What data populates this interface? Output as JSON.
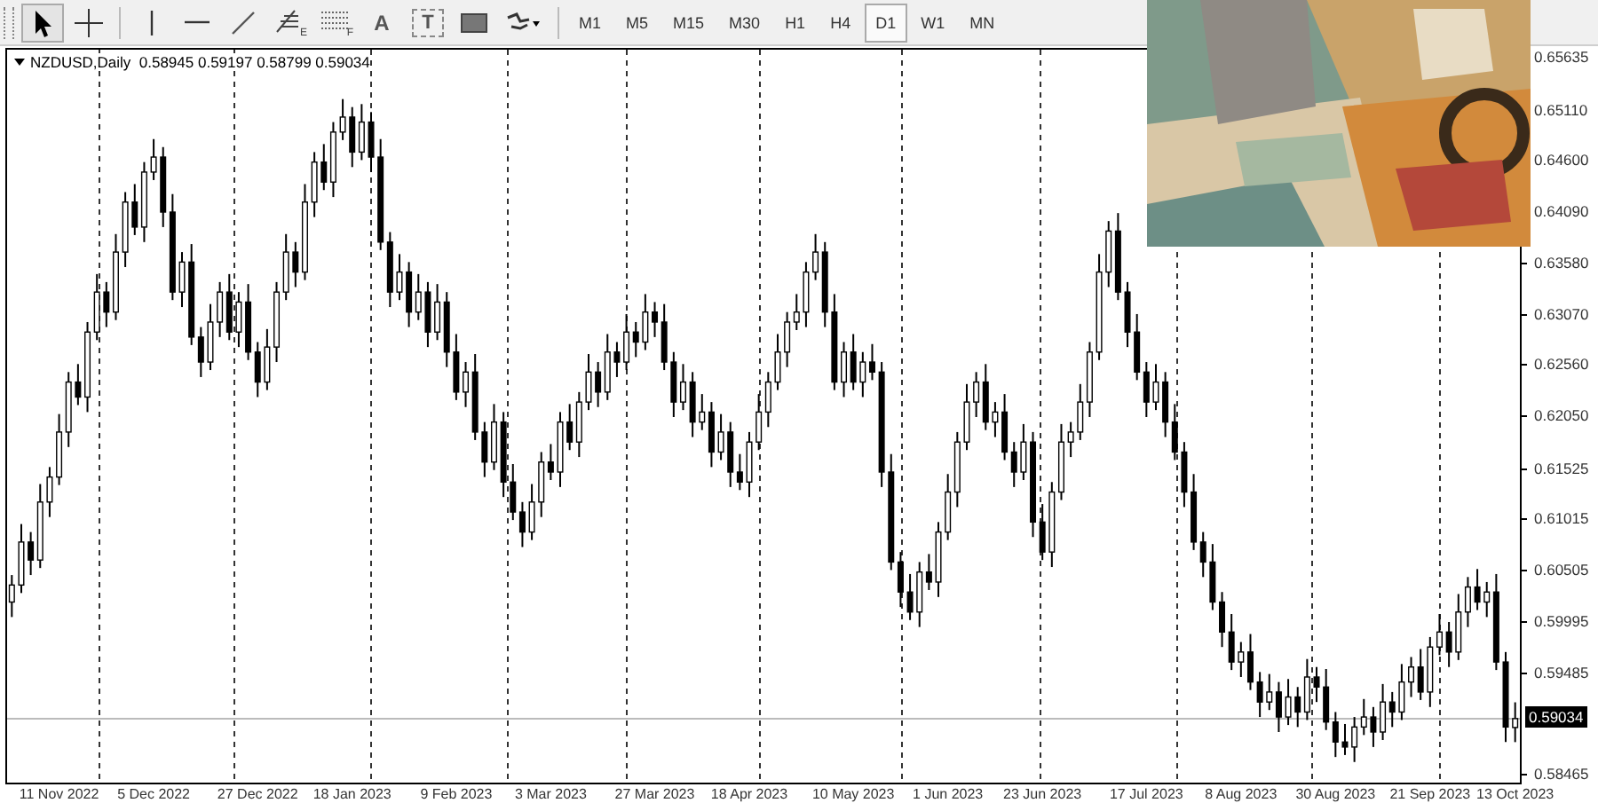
{
  "toolbar": {
    "tools": [
      {
        "kind": "cursor",
        "selected": true
      },
      {
        "kind": "crosshair",
        "selected": false
      },
      {
        "kind": "vline",
        "selected": false
      },
      {
        "kind": "hline",
        "selected": false
      },
      {
        "kind": "trend",
        "selected": false
      },
      {
        "kind": "fibo",
        "label": "E",
        "selected": false
      },
      {
        "kind": "grid",
        "label": "F",
        "selected": false
      },
      {
        "kind": "text",
        "label": "A",
        "selected": false
      },
      {
        "kind": "textlabel",
        "label": "T",
        "selected": false
      },
      {
        "kind": "rect",
        "selected": false
      },
      {
        "kind": "shapes",
        "selected": false
      }
    ],
    "timeframes": [
      {
        "label": "M1",
        "selected": false
      },
      {
        "label": "M5",
        "selected": false
      },
      {
        "label": "M15",
        "selected": false
      },
      {
        "label": "M30",
        "selected": false
      },
      {
        "label": "H1",
        "selected": false
      },
      {
        "label": "H4",
        "selected": false
      },
      {
        "label": "D1",
        "selected": true
      },
      {
        "label": "W1",
        "selected": false
      },
      {
        "label": "MN",
        "selected": false
      }
    ]
  },
  "chart": {
    "header": "NZDUSD,Daily  0.58945 0.59197 0.58799 0.59034",
    "last_price": "0.59034",
    "chart_data": {
      "type": "candlestick",
      "categories": [
        null,
        null,
        null,
        null,
        null,
        "11 Nov 2022",
        null,
        null,
        null,
        null,
        null,
        null,
        null,
        null,
        null,
        "5 Dec 2022",
        null,
        null,
        null,
        null,
        null,
        null,
        null,
        null,
        null,
        null,
        "27 Dec 2022",
        null,
        null,
        null,
        null,
        null,
        null,
        null,
        null,
        null,
        "18 Jan 2023",
        null,
        null,
        null,
        null,
        null,
        null,
        null,
        null,
        null,
        null,
        "9 Feb 2023",
        null,
        null,
        null,
        null,
        null,
        null,
        null,
        null,
        null,
        "3 Mar 2023",
        null,
        null,
        null,
        null,
        null,
        null,
        null,
        null,
        null,
        null,
        "27 Mar 2023",
        null,
        null,
        null,
        null,
        null,
        null,
        null,
        null,
        null,
        "18 Apr 2023",
        null,
        null,
        null,
        null,
        null,
        null,
        null,
        null,
        null,
        null,
        "10 May 2023",
        null,
        null,
        null,
        null,
        null,
        null,
        null,
        null,
        null,
        "1 Jun 2023",
        null,
        null,
        null,
        null,
        null,
        null,
        null,
        null,
        null,
        "23 Jun 2023",
        null,
        null,
        null,
        null,
        null,
        null,
        null,
        null,
        null,
        null,
        "17 Jul 2023",
        null,
        null,
        null,
        null,
        null,
        null,
        null,
        null,
        null,
        "8 Aug 2023",
        null,
        null,
        null,
        null,
        null,
        null,
        null,
        null,
        null,
        "30 Aug 2023",
        null,
        null,
        null,
        null,
        null,
        null,
        null,
        null,
        null,
        "21 Sep 2023",
        null,
        null,
        null,
        null,
        null,
        null,
        null,
        null,
        "13 Oct 2023"
      ],
      "ohlc": [
        [
          0.602,
          0.6047,
          0.6005,
          0.6037
        ],
        [
          0.6037,
          0.6098,
          0.6029,
          0.608
        ],
        [
          0.608,
          0.609,
          0.6047,
          0.6062
        ],
        [
          0.6062,
          0.6138,
          0.6054,
          0.612
        ],
        [
          0.612,
          0.6155,
          0.6105,
          0.6145
        ],
        [
          0.6145,
          0.6208,
          0.6137,
          0.619
        ],
        [
          0.619,
          0.625,
          0.6175,
          0.624
        ],
        [
          0.624,
          0.6258,
          0.6217,
          0.6225
        ],
        [
          0.6225,
          0.63,
          0.621,
          0.629
        ],
        [
          0.629,
          0.6348,
          0.6282,
          0.633
        ],
        [
          0.633,
          0.634,
          0.6295,
          0.631
        ],
        [
          0.631,
          0.6388,
          0.6302,
          0.637
        ],
        [
          0.637,
          0.643,
          0.6355,
          0.642
        ],
        [
          0.642,
          0.6438,
          0.6387,
          0.6395
        ],
        [
          0.6395,
          0.646,
          0.638,
          0.645
        ],
        [
          0.645,
          0.6483,
          0.6442,
          0.6465
        ],
        [
          0.6465,
          0.6475,
          0.6395,
          0.641
        ],
        [
          0.641,
          0.6428,
          0.6322,
          0.633
        ],
        [
          0.633,
          0.637,
          0.6315,
          0.636
        ],
        [
          0.636,
          0.6378,
          0.6277,
          0.6285
        ],
        [
          0.6285,
          0.6295,
          0.6245,
          0.626
        ],
        [
          0.626,
          0.6318,
          0.6252,
          0.63
        ],
        [
          0.63,
          0.634,
          0.6285,
          0.633
        ],
        [
          0.633,
          0.6348,
          0.6282,
          0.629
        ],
        [
          0.629,
          0.633,
          0.6275,
          0.632
        ],
        [
          0.632,
          0.6338,
          0.6262,
          0.627
        ],
        [
          0.627,
          0.628,
          0.6225,
          0.624
        ],
        [
          0.624,
          0.6293,
          0.6232,
          0.6275
        ],
        [
          0.6275,
          0.634,
          0.626,
          0.633
        ],
        [
          0.633,
          0.6388,
          0.6322,
          0.637
        ],
        [
          0.637,
          0.638,
          0.6335,
          0.635
        ],
        [
          0.635,
          0.6438,
          0.6342,
          0.642
        ],
        [
          0.642,
          0.647,
          0.6405,
          0.646
        ],
        [
          0.646,
          0.6478,
          0.6432,
          0.644
        ],
        [
          0.644,
          0.65,
          0.6425,
          0.649
        ],
        [
          0.649,
          0.6523,
          0.6482,
          0.6505
        ],
        [
          0.6505,
          0.6515,
          0.6455,
          0.647
        ],
        [
          0.647,
          0.6518,
          0.6462,
          0.65
        ],
        [
          0.65,
          0.651,
          0.645,
          0.6465
        ],
        [
          0.6465,
          0.6483,
          0.6372,
          0.638
        ],
        [
          0.638,
          0.639,
          0.6315,
          0.633
        ],
        [
          0.633,
          0.6368,
          0.6322,
          0.635
        ],
        [
          0.635,
          0.636,
          0.6295,
          0.631
        ],
        [
          0.631,
          0.6348,
          0.6302,
          0.633
        ],
        [
          0.633,
          0.634,
          0.6275,
          0.629
        ],
        [
          0.629,
          0.6338,
          0.6282,
          0.632
        ],
        [
          0.632,
          0.633,
          0.6255,
          0.627
        ],
        [
          0.627,
          0.6288,
          0.6222,
          0.623
        ],
        [
          0.623,
          0.626,
          0.6215,
          0.625
        ],
        [
          0.625,
          0.6268,
          0.6182,
          0.619
        ],
        [
          0.619,
          0.62,
          0.6145,
          0.616
        ],
        [
          0.616,
          0.6218,
          0.6152,
          0.62
        ],
        [
          0.62,
          0.621,
          0.6125,
          0.614
        ],
        [
          0.614,
          0.6158,
          0.6102,
          0.611
        ],
        [
          0.611,
          0.612,
          0.6075,
          0.609
        ],
        [
          0.609,
          0.6138,
          0.6082,
          0.612
        ],
        [
          0.612,
          0.617,
          0.6105,
          0.616
        ],
        [
          0.616,
          0.6178,
          0.6142,
          0.615
        ],
        [
          0.615,
          0.621,
          0.6135,
          0.62
        ],
        [
          0.62,
          0.6218,
          0.6172,
          0.618
        ],
        [
          0.618,
          0.623,
          0.6165,
          0.622
        ],
        [
          0.622,
          0.6268,
          0.6212,
          0.625
        ],
        [
          0.625,
          0.626,
          0.6215,
          0.623
        ],
        [
          0.623,
          0.6288,
          0.6222,
          0.627
        ],
        [
          0.627,
          0.628,
          0.6245,
          0.626
        ],
        [
          0.626,
          0.6308,
          0.6252,
          0.629
        ],
        [
          0.629,
          0.63,
          0.6265,
          0.628
        ],
        [
          0.628,
          0.6328,
          0.6272,
          0.631
        ],
        [
          0.631,
          0.632,
          0.6285,
          0.63
        ],
        [
          0.63,
          0.6318,
          0.6252,
          0.626
        ],
        [
          0.626,
          0.627,
          0.6205,
          0.622
        ],
        [
          0.622,
          0.6258,
          0.6212,
          0.624
        ],
        [
          0.624,
          0.625,
          0.6185,
          0.62
        ],
        [
          0.62,
          0.6228,
          0.6192,
          0.621
        ],
        [
          0.621,
          0.622,
          0.6155,
          0.617
        ],
        [
          0.617,
          0.6208,
          0.6162,
          0.619
        ],
        [
          0.619,
          0.62,
          0.6135,
          0.615
        ],
        [
          0.615,
          0.6168,
          0.6132,
          0.614
        ],
        [
          0.614,
          0.619,
          0.6125,
          0.618
        ],
        [
          0.618,
          0.6228,
          0.6172,
          0.621
        ],
        [
          0.621,
          0.625,
          0.6195,
          0.624
        ],
        [
          0.624,
          0.6288,
          0.6232,
          0.627
        ],
        [
          0.627,
          0.631,
          0.6255,
          0.63
        ],
        [
          0.63,
          0.6328,
          0.6292,
          0.631
        ],
        [
          0.631,
          0.636,
          0.6295,
          0.635
        ],
        [
          0.635,
          0.6388,
          0.6342,
          0.637
        ],
        [
          0.637,
          0.638,
          0.6295,
          0.631
        ],
        [
          0.631,
          0.6328,
          0.6232,
          0.624
        ],
        [
          0.624,
          0.628,
          0.6225,
          0.627
        ],
        [
          0.627,
          0.6288,
          0.6232,
          0.624
        ],
        [
          0.624,
          0.627,
          0.6225,
          0.626
        ],
        [
          0.626,
          0.6278,
          0.6242,
          0.625
        ],
        [
          0.625,
          0.626,
          0.6135,
          0.615
        ],
        [
          0.615,
          0.6168,
          0.6052,
          0.606
        ],
        [
          0.606,
          0.607,
          0.6015,
          0.603
        ],
        [
          0.603,
          0.6048,
          0.6002,
          0.601
        ],
        [
          0.601,
          0.606,
          0.5995,
          0.605
        ],
        [
          0.605,
          0.6068,
          0.6032,
          0.604
        ],
        [
          0.604,
          0.61,
          0.6025,
          0.609
        ],
        [
          0.609,
          0.6148,
          0.6082,
          0.613
        ],
        [
          0.613,
          0.619,
          0.6115,
          0.618
        ],
        [
          0.618,
          0.6238,
          0.6172,
          0.622
        ],
        [
          0.622,
          0.625,
          0.6205,
          0.624
        ],
        [
          0.624,
          0.6258,
          0.6192,
          0.62
        ],
        [
          0.62,
          0.622,
          0.6185,
          0.621
        ],
        [
          0.621,
          0.6228,
          0.6162,
          0.617
        ],
        [
          0.617,
          0.618,
          0.6135,
          0.615
        ],
        [
          0.615,
          0.6198,
          0.6142,
          0.618
        ],
        [
          0.618,
          0.619,
          0.6085,
          0.61
        ],
        [
          0.61,
          0.6118,
          0.6062,
          0.607
        ],
        [
          0.607,
          0.614,
          0.6055,
          0.613
        ],
        [
          0.613,
          0.6198,
          0.6122,
          0.618
        ],
        [
          0.618,
          0.62,
          0.6165,
          0.619
        ],
        [
          0.619,
          0.6238,
          0.6182,
          0.622
        ],
        [
          0.622,
          0.628,
          0.6205,
          0.627
        ],
        [
          0.627,
          0.6368,
          0.6262,
          0.635
        ],
        [
          0.635,
          0.6401,
          0.6335,
          0.6391
        ],
        [
          0.6391,
          0.6409,
          0.6322,
          0.633
        ],
        [
          0.633,
          0.634,
          0.6275,
          0.629
        ],
        [
          0.629,
          0.6308,
          0.6242,
          0.625
        ],
        [
          0.625,
          0.626,
          0.6205,
          0.622
        ],
        [
          0.622,
          0.6258,
          0.6212,
          0.624
        ],
        [
          0.624,
          0.625,
          0.6185,
          0.62
        ],
        [
          0.62,
          0.6218,
          0.6162,
          0.617
        ],
        [
          0.617,
          0.618,
          0.6115,
          0.613
        ],
        [
          0.613,
          0.6148,
          0.6072,
          0.608
        ],
        [
          0.608,
          0.609,
          0.6045,
          0.606
        ],
        [
          0.606,
          0.6078,
          0.6012,
          0.602
        ],
        [
          0.602,
          0.603,
          0.5975,
          0.599
        ],
        [
          0.599,
          0.6008,
          0.5952,
          0.596
        ],
        [
          0.596,
          0.598,
          0.5945,
          0.597
        ],
        [
          0.597,
          0.5988,
          0.5932,
          0.594
        ],
        [
          0.594,
          0.595,
          0.5905,
          0.592
        ],
        [
          0.592,
          0.5948,
          0.5912,
          0.593
        ],
        [
          0.593,
          0.594,
          0.589,
          0.5905
        ],
        [
          0.5905,
          0.5943,
          0.5897,
          0.5925
        ],
        [
          0.5925,
          0.5935,
          0.5895,
          0.591
        ],
        [
          0.591,
          0.5963,
          0.5902,
          0.5945
        ],
        [
          0.5945,
          0.5955,
          0.592,
          0.5935
        ],
        [
          0.5935,
          0.5953,
          0.5892,
          0.59
        ],
        [
          0.59,
          0.591,
          0.5865,
          0.588
        ],
        [
          0.588,
          0.5898,
          0.5867,
          0.5875
        ],
        [
          0.5875,
          0.5905,
          0.586,
          0.5895
        ],
        [
          0.5895,
          0.5923,
          0.5887,
          0.5905
        ],
        [
          0.5905,
          0.5915,
          0.5875,
          0.589
        ],
        [
          0.589,
          0.5938,
          0.5882,
          0.592
        ],
        [
          0.592,
          0.593,
          0.5895,
          0.591
        ],
        [
          0.591,
          0.5958,
          0.5902,
          0.594
        ],
        [
          0.594,
          0.5965,
          0.5925,
          0.5955
        ],
        [
          0.5955,
          0.5973,
          0.5922,
          0.593
        ],
        [
          0.593,
          0.5985,
          0.5915,
          0.5975
        ],
        [
          0.5975,
          0.6008,
          0.5967,
          0.599
        ],
        [
          0.599,
          0.6,
          0.5955,
          0.597
        ],
        [
          0.597,
          0.6028,
          0.5962,
          0.601
        ],
        [
          0.601,
          0.6045,
          0.5995,
          0.6035
        ],
        [
          0.6035,
          0.6053,
          0.6012,
          0.602
        ],
        [
          0.602,
          0.604,
          0.6005,
          0.603
        ],
        [
          0.603,
          0.6048,
          0.5952,
          0.596
        ],
        [
          0.596,
          0.597,
          0.588,
          0.5895
        ],
        [
          0.58945,
          0.59197,
          0.58799,
          0.59034
        ]
      ],
      "ylim": [
        0.58394,
        0.65724
      ],
      "ref_lines": [
        {
          "axis": "y",
          "value": 0.59034
        }
      ],
      "yticks": [
        {
          "value": 0.65635,
          "label": "0.65635"
        },
        {
          "value": 0.6511,
          "label": "0.65110"
        },
        {
          "value": 0.646,
          "label": "0.64600"
        },
        {
          "value": 0.6409,
          "label": "0.64090"
        },
        {
          "value": 0.6358,
          "label": "0.63580"
        },
        {
          "value": 0.6307,
          "label": "0.63070"
        },
        {
          "value": 0.6256,
          "label": "0.62560"
        },
        {
          "value": 0.6205,
          "label": "0.62050"
        },
        {
          "value": 0.61525,
          "label": "0.61525"
        },
        {
          "value": 0.61015,
          "label": "0.61015"
        },
        {
          "value": 0.60505,
          "label": "0.60505"
        },
        {
          "value": 0.59995,
          "label": "0.59995"
        },
        {
          "value": 0.59485,
          "label": "0.59485"
        },
        {
          "value": 0.58465,
          "label": "0.58465"
        }
      ]
    }
  }
}
